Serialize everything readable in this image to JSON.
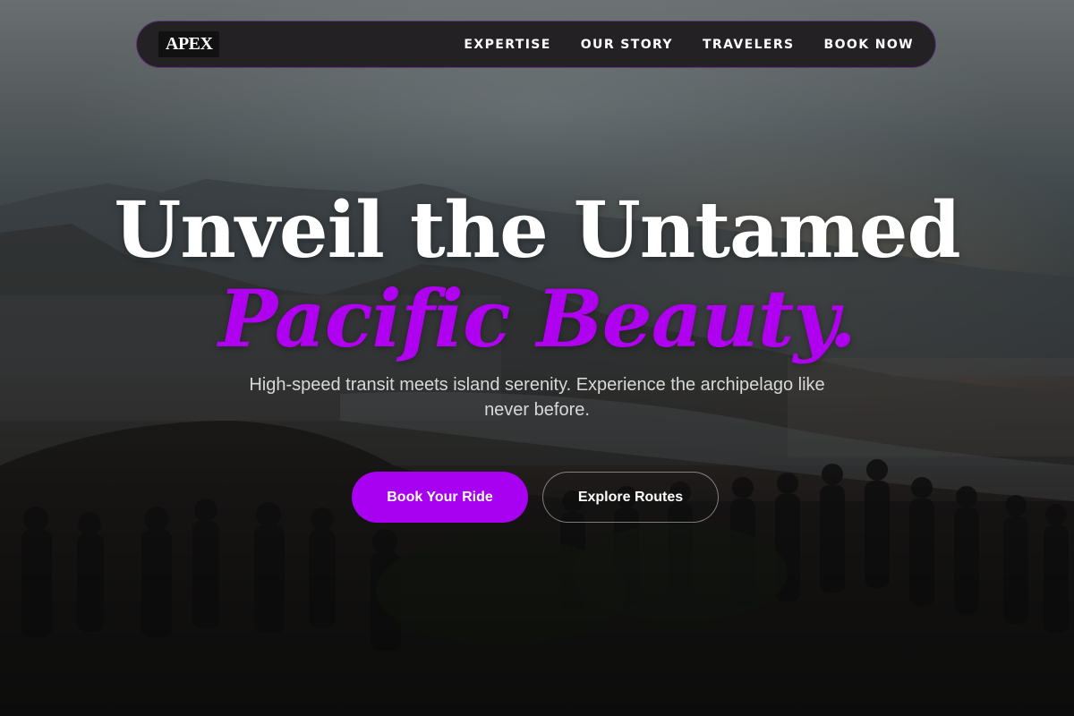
{
  "brand": {
    "logo_text": "APEX"
  },
  "nav": {
    "links": [
      {
        "label": "EXPERTISE"
      },
      {
        "label": "OUR STORY"
      },
      {
        "label": "TRAVELERS"
      },
      {
        "label": "BOOK NOW"
      }
    ]
  },
  "hero": {
    "title_line1": "Unveil the Untamed",
    "title_line2": "Pacific Beauty.",
    "subtitle": "High-speed transit meets island serenity. Experience the archipelago like never before."
  },
  "actions": {
    "primary_label": "Book Your Ride",
    "secondary_label": "Explore Routes"
  },
  "colors": {
    "accent": "#a800f0",
    "nav_background": "#201e20",
    "text_primary": "#ffffff"
  }
}
